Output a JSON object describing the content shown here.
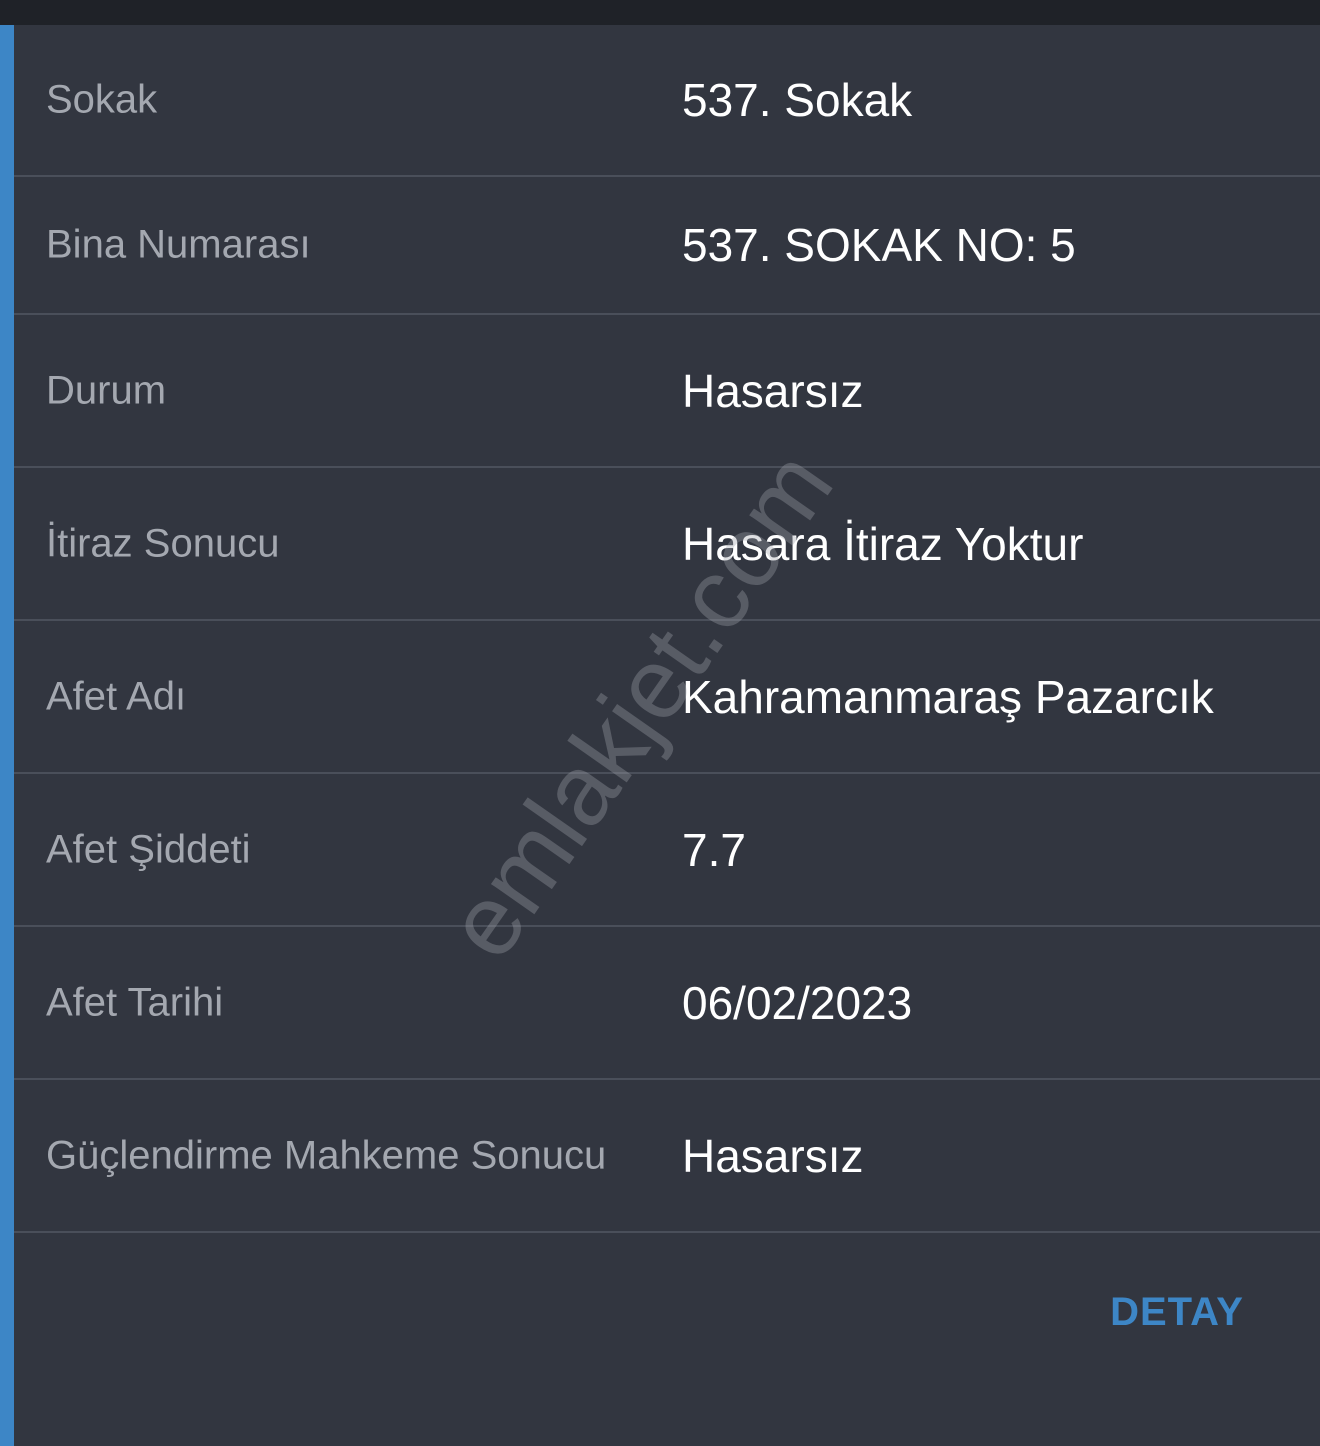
{
  "rows": [
    {
      "label": "Sokak",
      "value": "537. Sokak"
    },
    {
      "label": "Bina Numarası",
      "value": "537. SOKAK NO: 5"
    },
    {
      "label": "Durum",
      "value": "Hasarsız"
    },
    {
      "label": "İtiraz Sonucu",
      "value": "Hasara İtiraz Yoktur"
    },
    {
      "label": "Afet Adı",
      "value": "Kahramanmaraş Pazarcık"
    },
    {
      "label": "Afet Şiddeti",
      "value": "7.7"
    },
    {
      "label": "Afet Tarihi",
      "value": "06/02/2023"
    },
    {
      "label": "Güçlendirme Mahkeme Sonucu",
      "value": "Hasarsız"
    }
  ],
  "detail_button": "DETAY",
  "watermark": "emlakjet.com",
  "colors": {
    "background": "#323640",
    "accent": "#3d86c6",
    "label": "#a4a8b0",
    "value": "#ffffff",
    "divider": "#4a4f5a"
  }
}
